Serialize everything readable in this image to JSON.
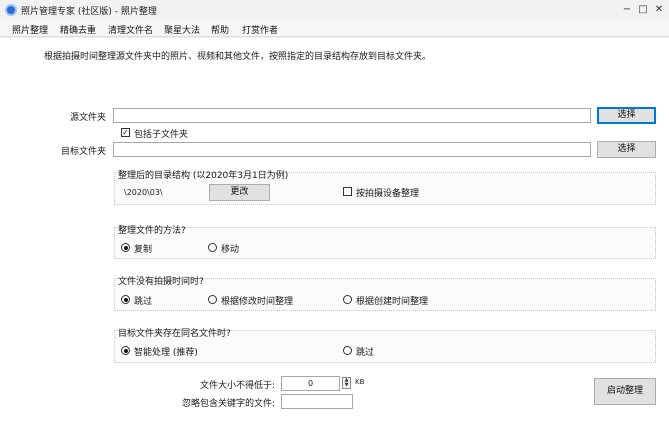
{
  "window": {
    "title": "照片管理专家 (社区版) - 照片整理",
    "controls": {
      "minimize": "−",
      "maximize": "□",
      "close": "✕"
    }
  },
  "menu": [
    "照片整理",
    "精确去重",
    "清理文件名",
    "聚星大法",
    "帮助",
    "打赏作者"
  ],
  "description": "根据拍摄时间整理源文件夹中的照片、视频和其他文件，按照指定的目录结构存放到目标文件夹。",
  "source": {
    "label": "源文件夹",
    "value": "",
    "browse_label": "选择",
    "include_sub_label": "包括子文件夹",
    "include_sub_checked": true
  },
  "target": {
    "label": "目标文件夹",
    "value": "",
    "browse_label": "选择"
  },
  "structure": {
    "heading": "整理后的目录结构 (以2020年3月1日为例)",
    "example": "\\2020\\03\\",
    "change_label": "更改",
    "by_device_label": "按拍摄设备整理",
    "by_device_checked": false
  },
  "method": {
    "heading": "整理文件的方法?",
    "options": [
      "复制",
      "移动"
    ],
    "selected": 0
  },
  "no_time": {
    "heading": "文件没有拍摄时间时?",
    "options": [
      "跳过",
      "根据修改时间整理",
      "根据创建时间整理"
    ],
    "selected": 0
  },
  "duplicate": {
    "heading": "目标文件夹存在同名文件时?",
    "options": [
      "智能处理 (推荐)",
      "跳过"
    ],
    "selected": 0
  },
  "min_size": {
    "label": "文件大小不得低于:",
    "value": "0",
    "unit": "KB"
  },
  "ignore": {
    "label": "忽略包含关键字的文件:",
    "value": ""
  },
  "start_label": "启动整理",
  "colors": {
    "accent": "#0078d7",
    "app_icon": "#2b6fd4"
  }
}
